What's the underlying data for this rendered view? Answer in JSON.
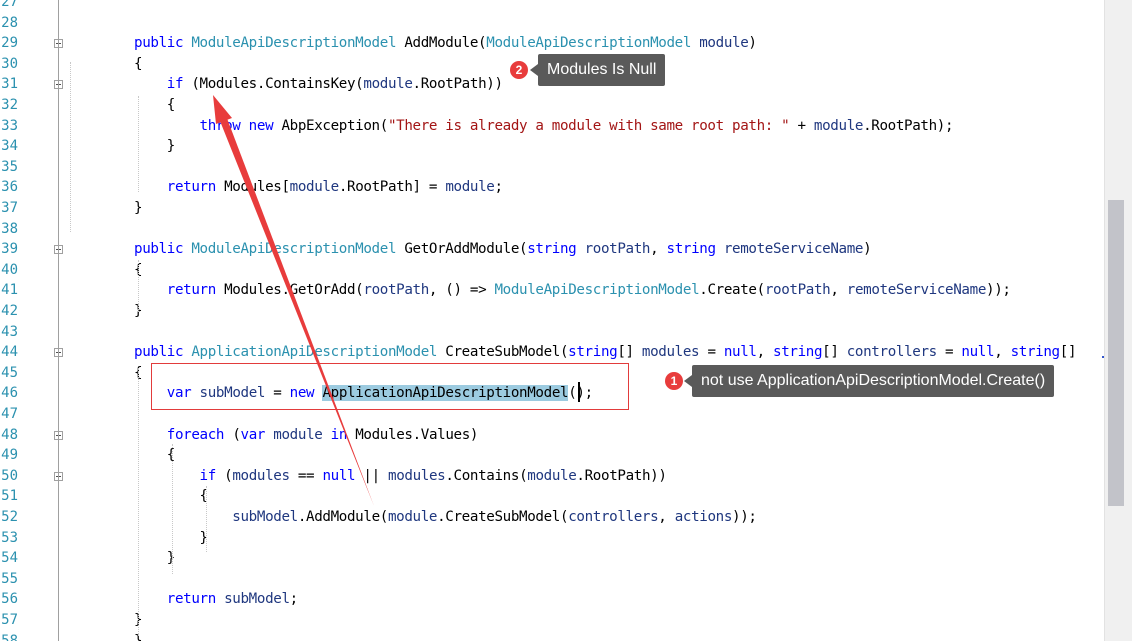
{
  "editor": {
    "lines": [
      {
        "n": "27",
        "t": []
      },
      {
        "n": "28",
        "t": []
      },
      {
        "n": "29",
        "t": [
          [
            "kw",
            "public "
          ],
          [
            "ty",
            "ModuleApiDescriptionModel"
          ],
          [
            "nm",
            " AddModule("
          ],
          [
            "ty",
            "ModuleApiDescriptionModel"
          ],
          [
            "par",
            " module"
          ],
          [
            "nm",
            ")"
          ]
        ]
      },
      {
        "n": "30",
        "t": [
          [
            "nm",
            "{"
          ]
        ]
      },
      {
        "n": "31",
        "t": [
          [
            "kw",
            "    if "
          ],
          [
            "nm",
            "(Modules.ContainsKey("
          ],
          [
            "par",
            "module"
          ],
          [
            "nm",
            ".RootPath))"
          ]
        ]
      },
      {
        "n": "32",
        "t": [
          [
            "nm",
            "    {"
          ]
        ]
      },
      {
        "n": "33",
        "t": [
          [
            "kw",
            "        throw new "
          ],
          [
            "nm",
            "AbpException("
          ],
          [
            "str",
            "\"There is already a module with same root path: \""
          ],
          [
            "nm",
            " + "
          ],
          [
            "par",
            "module"
          ],
          [
            "nm",
            ".RootPath);"
          ]
        ]
      },
      {
        "n": "34",
        "t": [
          [
            "nm",
            "    }"
          ]
        ]
      },
      {
        "n": "35",
        "t": []
      },
      {
        "n": "36",
        "t": [
          [
            "kw",
            "    return "
          ],
          [
            "nm",
            "Modules["
          ],
          [
            "par",
            "module"
          ],
          [
            "nm",
            ".RootPath] = "
          ],
          [
            "par",
            "module"
          ],
          [
            "nm",
            ";"
          ]
        ]
      },
      {
        "n": "37",
        "t": [
          [
            "nm",
            "}"
          ]
        ]
      },
      {
        "n": "38",
        "t": []
      },
      {
        "n": "39",
        "t": [
          [
            "kw",
            "public "
          ],
          [
            "ty",
            "ModuleApiDescriptionModel"
          ],
          [
            "nm",
            " GetOrAddModule("
          ],
          [
            "kw",
            "string"
          ],
          [
            "par",
            " rootPath"
          ],
          [
            "nm",
            ", "
          ],
          [
            "kw",
            "string"
          ],
          [
            "par",
            " remoteServiceName"
          ],
          [
            "nm",
            ")"
          ]
        ]
      },
      {
        "n": "40",
        "t": [
          [
            "nm",
            "{"
          ]
        ]
      },
      {
        "n": "41",
        "t": [
          [
            "kw",
            "    return "
          ],
          [
            "nm",
            "Modules.GetOrAdd("
          ],
          [
            "par",
            "rootPath"
          ],
          [
            "nm",
            ", () => "
          ],
          [
            "ty",
            "ModuleApiDescriptionModel"
          ],
          [
            "nm",
            ".Create("
          ],
          [
            "par",
            "rootPath"
          ],
          [
            "nm",
            ", "
          ],
          [
            "par",
            "remoteServiceName"
          ],
          [
            "nm",
            "));"
          ]
        ]
      },
      {
        "n": "42",
        "t": [
          [
            "nm",
            "}"
          ]
        ]
      },
      {
        "n": "43",
        "t": []
      },
      {
        "n": "44",
        "t": [
          [
            "kw",
            "public "
          ],
          [
            "ty",
            "ApplicationApiDescriptionModel"
          ],
          [
            "nm",
            " CreateSubModel("
          ],
          [
            "kw",
            "string"
          ],
          [
            "nm",
            "[] "
          ],
          [
            "par",
            "modules"
          ],
          [
            "nm",
            " = "
          ],
          [
            "kw",
            "null"
          ],
          [
            "nm",
            ", "
          ],
          [
            "kw",
            "string"
          ],
          [
            "nm",
            "[] "
          ],
          [
            "par",
            "controllers"
          ],
          [
            "nm",
            " = "
          ],
          [
            "kw",
            "null"
          ],
          [
            "nm",
            ", "
          ],
          [
            "kw",
            "string"
          ],
          [
            "nm",
            "[]"
          ]
        ]
      },
      {
        "n": "45",
        "t": [
          [
            "nm",
            "{"
          ]
        ]
      },
      {
        "n": "46",
        "t": [
          [
            "kw",
            "    var "
          ],
          [
            "par",
            "subModel"
          ],
          [
            "nm",
            " = "
          ],
          [
            "kw",
            "new "
          ],
          [
            "hl",
            "ApplicationApiDescriptionModel"
          ],
          [
            "nm",
            "();"
          ]
        ]
      },
      {
        "n": "47",
        "t": []
      },
      {
        "n": "48",
        "t": [
          [
            "kw",
            "    foreach "
          ],
          [
            "nm",
            "("
          ],
          [
            "kw",
            "var "
          ],
          [
            "par",
            "module"
          ],
          [
            "kw",
            " in "
          ],
          [
            "nm",
            "Modules.Values)"
          ]
        ]
      },
      {
        "n": "49",
        "t": [
          [
            "nm",
            "    {"
          ]
        ]
      },
      {
        "n": "50",
        "t": [
          [
            "kw",
            "        if "
          ],
          [
            "nm",
            "("
          ],
          [
            "par",
            "modules"
          ],
          [
            "nm",
            " == "
          ],
          [
            "kw",
            "null"
          ],
          [
            "nm",
            " || "
          ],
          [
            "par",
            "modules"
          ],
          [
            "nm",
            ".Contains("
          ],
          [
            "par",
            "module"
          ],
          [
            "nm",
            ".RootPath))"
          ]
        ]
      },
      {
        "n": "51",
        "t": [
          [
            "nm",
            "        {"
          ]
        ]
      },
      {
        "n": "52",
        "t": [
          [
            "par",
            "            subModel"
          ],
          [
            "nm",
            ".AddModule("
          ],
          [
            "par",
            "module"
          ],
          [
            "nm",
            ".CreateSubModel("
          ],
          [
            "par",
            "controllers"
          ],
          [
            "nm",
            ", "
          ],
          [
            "par",
            "actions"
          ],
          [
            "nm",
            "));"
          ]
        ]
      },
      {
        "n": "53",
        "t": [
          [
            "nm",
            "        }"
          ]
        ]
      },
      {
        "n": "54",
        "t": [
          [
            "nm",
            "    }"
          ]
        ]
      },
      {
        "n": "55",
        "t": []
      },
      {
        "n": "56",
        "t": [
          [
            "kw",
            "    return "
          ],
          [
            "par",
            "subModel"
          ],
          [
            "nm",
            ";"
          ]
        ]
      },
      {
        "n": "57",
        "t": [
          [
            "nm",
            "}"
          ]
        ]
      },
      {
        "n": "58",
        "t": [
          [
            "nm",
            "}"
          ]
        ]
      }
    ]
  },
  "annotations": {
    "tip1_badge": "1",
    "tip1_text": "not use  ApplicationApiDescriptionModel.Create()",
    "tip2_badge": "2",
    "tip2_text": "Modules Is Null",
    "accent": "#e83c3c"
  }
}
